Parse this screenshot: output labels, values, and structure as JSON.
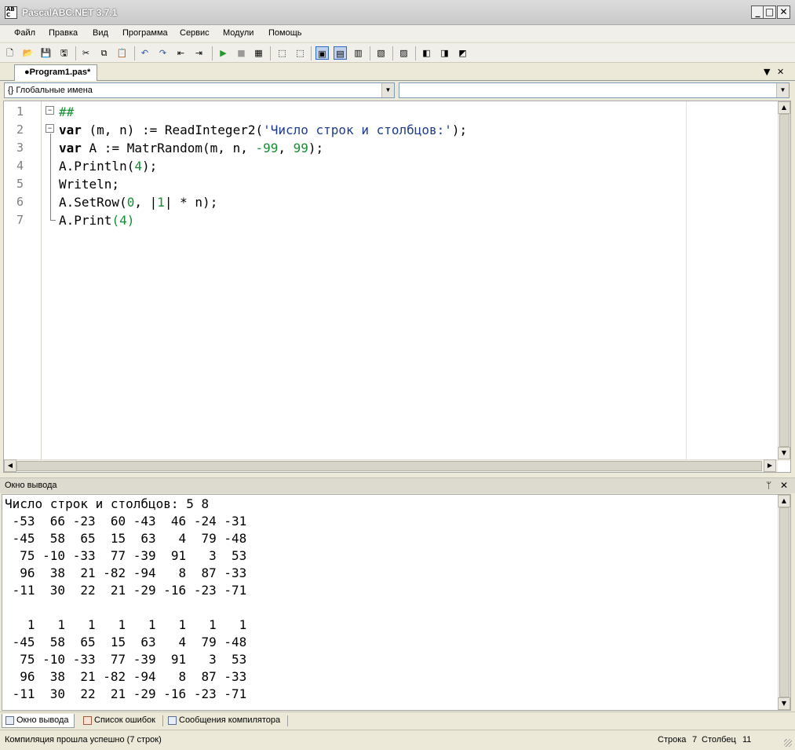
{
  "window": {
    "title": "PascalABC.NET 3.7.1",
    "icon_text": "AB\nC",
    "controls": {
      "minimize": "_",
      "maximize": "□",
      "close": "✕"
    }
  },
  "menu": [
    "Файл",
    "Правка",
    "Вид",
    "Программа",
    "Сервис",
    "Модули",
    "Помощь"
  ],
  "toolbar": {
    "icons": [
      "new-file-icon",
      "open-folder-icon",
      "save-icon",
      "save-all-icon",
      "cut-icon",
      "copy-icon",
      "paste-icon",
      "undo-icon",
      "redo-icon",
      "navigate-back-icon",
      "navigate-forward-icon",
      "run-icon",
      "stop-icon",
      "compile-icon",
      "debug-step-into-icon",
      "debug-step-over-icon",
      "console-window-icon",
      "text-window-icon",
      "format-code-icon",
      "comment-icon",
      "code-template-icon",
      "debug-run-icon",
      "debug-stop-icon",
      "debug-restart-icon"
    ],
    "glyphs": [
      "🗋",
      "📂",
      "💾",
      "🖫",
      "✂",
      "⧉",
      "📋",
      "↶",
      "↷",
      "⇤",
      "⇥",
      "▶",
      "■",
      "▦",
      "⬚",
      "⬚",
      "▣",
      "▤",
      "▥",
      "▧",
      "▨",
      "◧",
      "◨",
      "◩"
    ]
  },
  "editor_tabs": {
    "active_tab": "●Program1.pas*",
    "dropdown": "▼",
    "close": "✕"
  },
  "namespace": {
    "left_combo": "{} Глобальные имена",
    "right_combo": "",
    "arrow": "▼"
  },
  "editor": {
    "line_numbers": [
      "1",
      "2",
      "3",
      "4",
      "5",
      "6",
      "7"
    ],
    "fold_markers": [
      "−",
      "−"
    ],
    "lines": [
      [
        {
          "t": "##",
          "c": "cmt"
        }
      ],
      [
        {
          "t": "var",
          "c": "kw"
        },
        {
          "t": " (m, n) := ReadInteger2(",
          "c": ""
        },
        {
          "t": "'Число строк и столбцов:'",
          "c": "str"
        },
        {
          "t": ");",
          "c": ""
        }
      ],
      [
        {
          "t": "var",
          "c": "kw"
        },
        {
          "t": " A := MatrRandom(m, n, ",
          "c": ""
        },
        {
          "t": "-99",
          "c": "num"
        },
        {
          "t": ", ",
          "c": ""
        },
        {
          "t": "99",
          "c": "num"
        },
        {
          "t": ");",
          "c": ""
        }
      ],
      [
        {
          "t": "A.Println(",
          "c": ""
        },
        {
          "t": "4",
          "c": "num"
        },
        {
          "t": ");",
          "c": ""
        }
      ],
      [
        {
          "t": "Writeln;",
          "c": ""
        }
      ],
      [
        {
          "t": "A.SetRow(",
          "c": ""
        },
        {
          "t": "0",
          "c": "num"
        },
        {
          "t": ", |",
          "c": ""
        },
        {
          "t": "1",
          "c": "num"
        },
        {
          "t": "| * n);",
          "c": ""
        }
      ],
      [
        {
          "t": "A.Print",
          "c": ""
        },
        {
          "t": "(4)",
          "c": "num"
        }
      ]
    ],
    "scroll": {
      "up": "▲",
      "down": "▼",
      "left": "◀",
      "right": "▶"
    }
  },
  "output_panel": {
    "title": "Окно вывода",
    "pin": "ᛘ",
    "close": "✕",
    "lines": [
      "Число строк и столбцов: 5 8",
      " -53  66 -23  60 -43  46 -24 -31",
      " -45  58  65  15  63   4  79 -48",
      "  75 -10 -33  77 -39  91   3  53",
      "  96  38  21 -82 -94   8  87 -33",
      " -11  30  22  21 -29 -16 -23 -71",
      "",
      "   1   1   1   1   1   1   1   1",
      " -45  58  65  15  63   4  79 -48",
      "  75 -10 -33  77 -39  91   3  53",
      "  96  38  21 -82 -94   8  87 -33",
      " -11  30  22  21 -29 -16 -23 -71"
    ]
  },
  "bottom_tabs": [
    "Окно вывода",
    "Список ошибок",
    "Сообщения компилятора"
  ],
  "status": {
    "message": "Компиляция прошла успешно (7 строк)",
    "row_label": "Строка",
    "row_value": "7",
    "col_label": "Столбец",
    "col_value": "11"
  }
}
